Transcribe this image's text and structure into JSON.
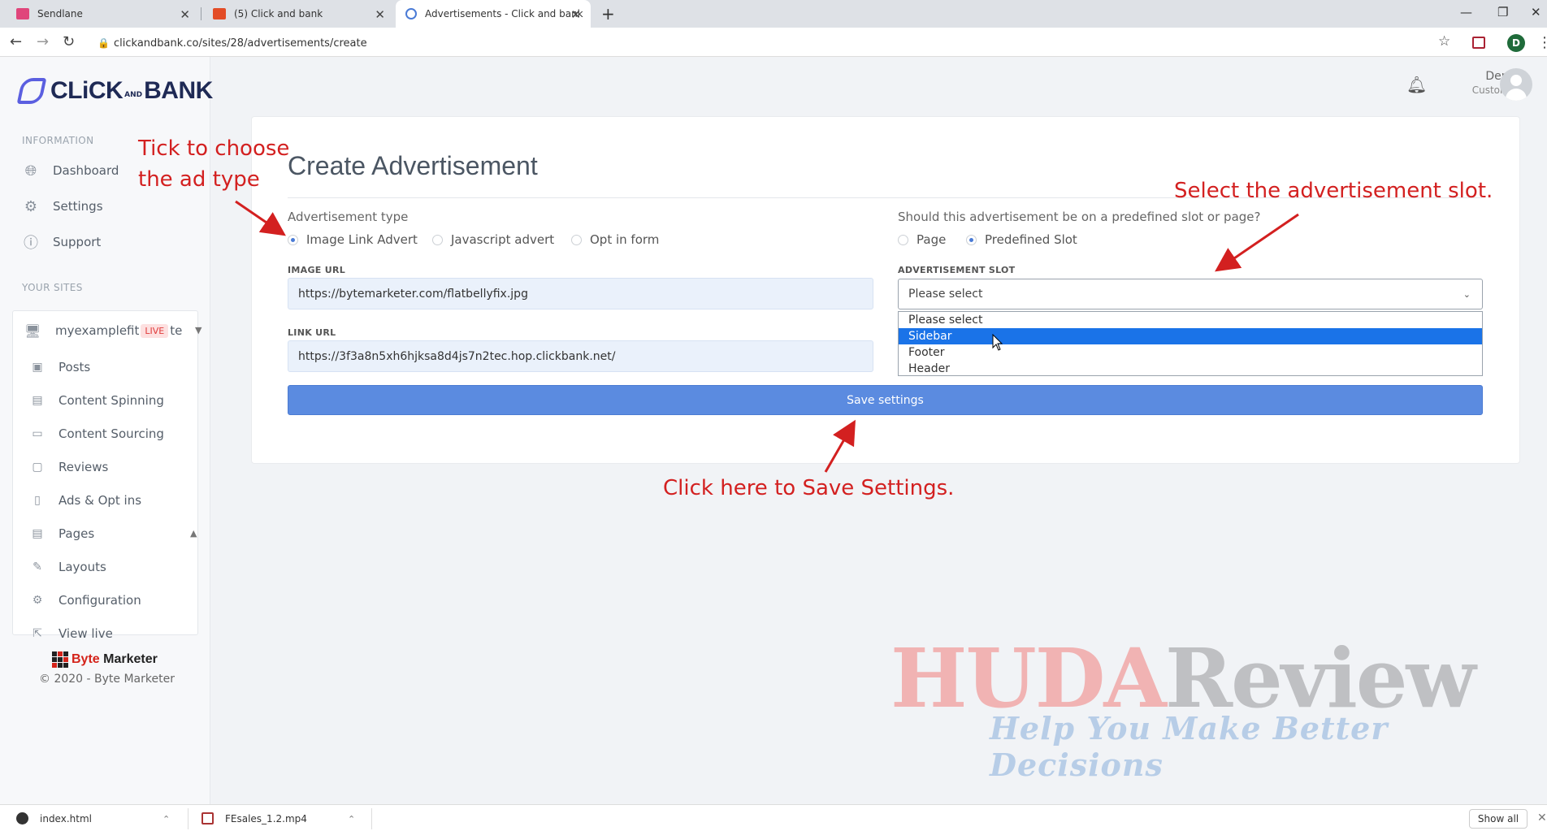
{
  "browser": {
    "tabs": [
      {
        "title": "Sendlane",
        "favicon_color": "#e0457b"
      },
      {
        "title": "(5) Click and bank",
        "favicon_color": "#e34c26"
      },
      {
        "title": "Advertisements - Click and bank",
        "favicon_color": "#4a7bd6"
      }
    ],
    "url": "clickandbank.co/sites/28/advertisements/create",
    "profile_initial": "D"
  },
  "brand": {
    "left": "CLiCK",
    "and": "AND",
    "right": "BANK",
    "color": "#1f2a55",
    "mark_color": "#5b5fe0"
  },
  "header": {
    "user_name": "Demo",
    "user_role": "Customer"
  },
  "sidebar": {
    "information_title": "INFORMATION",
    "info_items": [
      {
        "label": "Dashboard",
        "icon": "globe-icon"
      },
      {
        "label": "Settings",
        "icon": "gear-icon"
      },
      {
        "label": "Support",
        "icon": "help-icon"
      }
    ],
    "sites_title": "YOUR SITES",
    "site": {
      "name": "myexamplefit",
      "badge": "LIVE",
      "suffix": "te"
    },
    "site_items": [
      {
        "label": "Posts",
        "icon": "posts-icon"
      },
      {
        "label": "Content Spinning",
        "icon": "document-icon"
      },
      {
        "label": "Content Sourcing",
        "icon": "inbox-icon"
      },
      {
        "label": "Reviews",
        "icon": "comment-icon"
      },
      {
        "label": "Ads & Opt ins",
        "icon": "ad-icon"
      },
      {
        "label": "Pages",
        "icon": "pages-icon"
      },
      {
        "label": "Layouts",
        "icon": "brush-icon"
      },
      {
        "label": "Configuration",
        "icon": "gear-icon"
      },
      {
        "label": "View live",
        "icon": "external-link-icon"
      }
    ],
    "footer_brand": {
      "left": "Byte",
      "right": "Marketer"
    },
    "copyright": "© 2020 - Byte Marketer"
  },
  "form": {
    "title": "Create Advertisement",
    "ad_type_label": "Advertisement type",
    "ad_types": [
      {
        "label": "Image Link Advert",
        "selected": true
      },
      {
        "label": "Javascript advert",
        "selected": false
      },
      {
        "label": "Opt in form",
        "selected": false
      }
    ],
    "placement_label": "Should this advertisement be on a predefined slot or page?",
    "placements": [
      {
        "label": "Page",
        "selected": false
      },
      {
        "label": "Predefined Slot",
        "selected": true
      }
    ],
    "image_url_label": "IMAGE URL",
    "image_url_value": "https://bytemarketer.com/flatbellyfix.jpg",
    "link_url_label": "LINK URL",
    "link_url_value": "https://3f3a8n5xh6hjksa8d4js7n2tec.hop.clickbank.net/",
    "slot_label": "ADVERTISEMENT SLOT",
    "slot_value": "Please select",
    "slot_options": [
      {
        "label": "Please select",
        "highlighted": false
      },
      {
        "label": "Sidebar",
        "highlighted": true
      },
      {
        "label": "Footer",
        "highlighted": false
      },
      {
        "label": "Header",
        "highlighted": false
      }
    ],
    "save_label": "Save settings"
  },
  "annotations": {
    "ad_type_line1": "Tick to choose",
    "ad_type_line2": "the ad type",
    "slot": "Select the advertisement slot.",
    "save": "Click here to Save Settings.",
    "color": "#d32020"
  },
  "watermark": {
    "part1": "HUDA",
    "part2": "Review",
    "tagline": "Help You Make Better Decisions"
  },
  "downloads": {
    "items": [
      {
        "name": "index.html"
      },
      {
        "name": "FEsales_1.2.mp4"
      }
    ],
    "show_all": "Show all"
  }
}
